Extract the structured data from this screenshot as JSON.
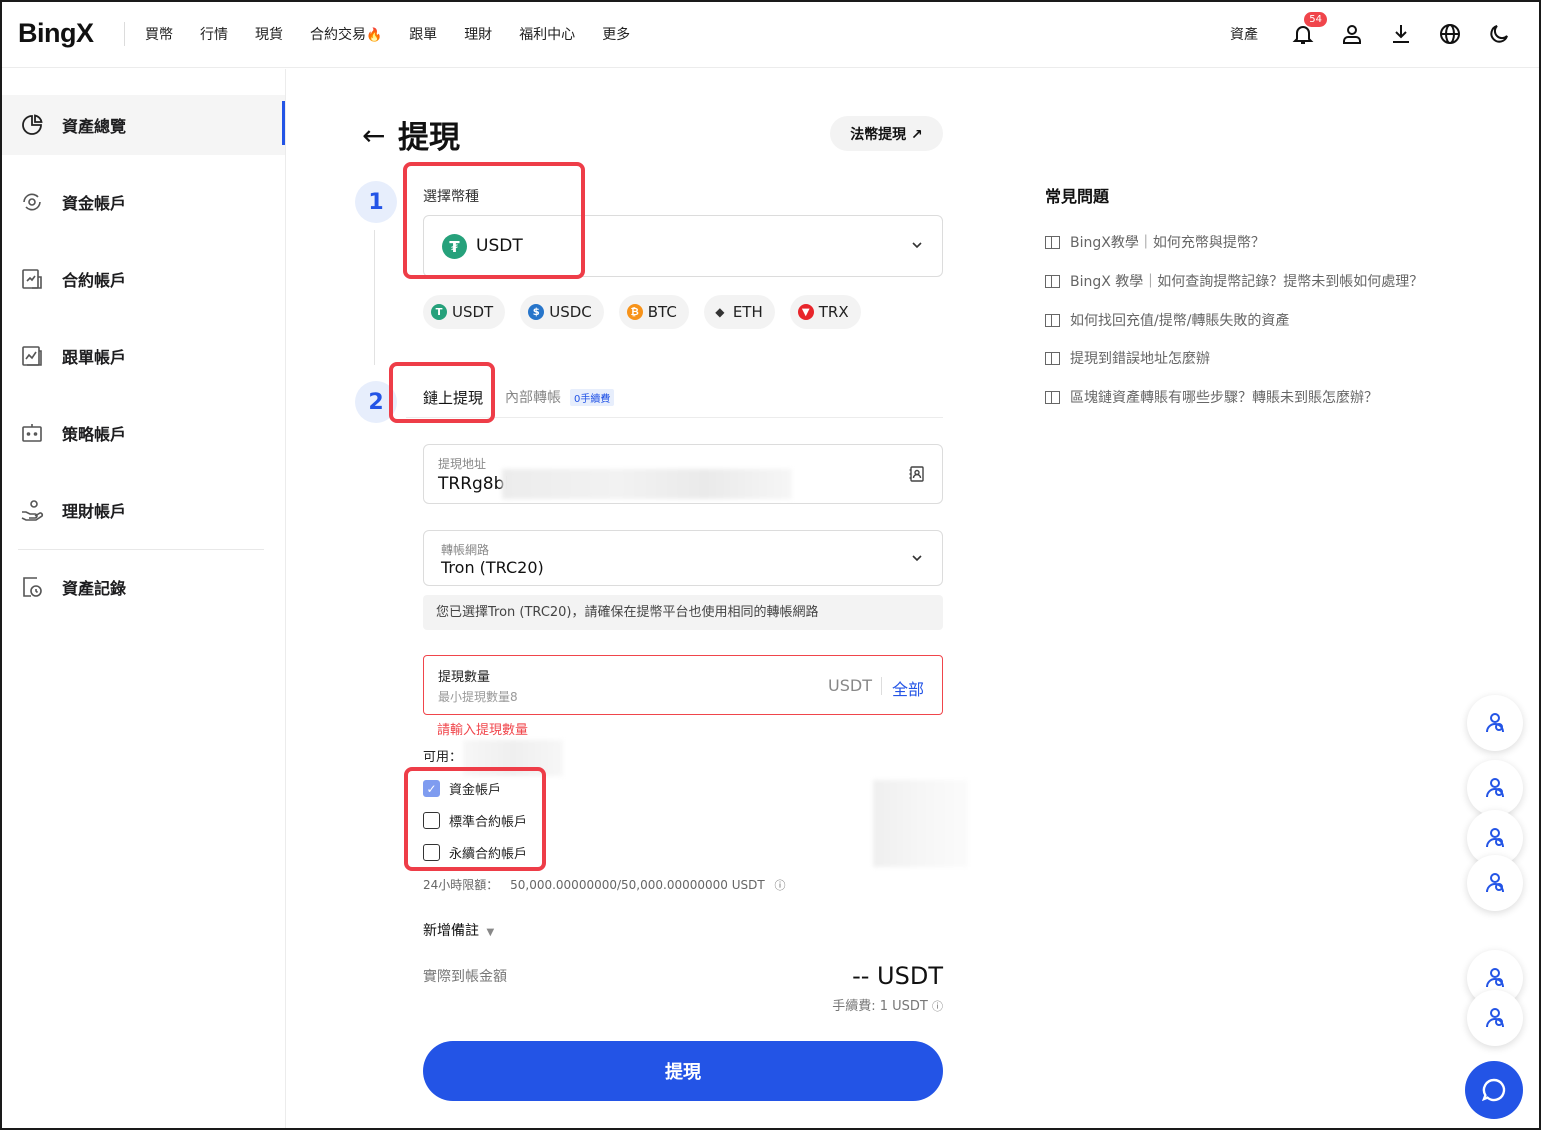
{
  "header": {
    "logo": "BingX",
    "nav": [
      "買幣",
      "行情",
      "現貨",
      "合約交易",
      "跟單",
      "理財",
      "福利中心",
      "更多"
    ],
    "assets_label": "資產",
    "notification_count": "54"
  },
  "sidebar": {
    "items": [
      {
        "label": "資產總覽",
        "icon": "pie-chart-icon",
        "active": true
      },
      {
        "label": "資金帳戶",
        "icon": "fund-refresh-icon"
      },
      {
        "label": "合約帳戶",
        "icon": "contract-chart-icon"
      },
      {
        "label": "跟單帳戶",
        "icon": "copy-trade-icon"
      },
      {
        "label": "策略帳戶",
        "icon": "robot-icon"
      },
      {
        "label": "理財帳戶",
        "icon": "hand-coin-icon"
      },
      {
        "label": "資產記錄",
        "icon": "record-clock-icon"
      }
    ]
  },
  "page": {
    "title": "提現",
    "fiat_button": "法幣提現 ↗"
  },
  "step1": {
    "number": "1",
    "label": "選擇幣種",
    "selected_coin": "USDT",
    "quick_coins": [
      {
        "name": "USDT",
        "color": "#26a17b",
        "glyph": "T"
      },
      {
        "name": "USDC",
        "color": "#2775ca",
        "glyph": "$"
      },
      {
        "name": "BTC",
        "color": "#f7931a",
        "glyph": "₿"
      },
      {
        "name": "ETH",
        "color": "#444444",
        "glyph": "◆"
      },
      {
        "name": "TRX",
        "color": "#e8252b",
        "glyph": "▼"
      }
    ]
  },
  "step2": {
    "number": "2",
    "tab_active": "鏈上提現",
    "tab_internal": "內部轉帳",
    "fee_tag": "0手續費",
    "address_label": "提現地址",
    "address_value": "TRRg8bl",
    "network_label": "轉帳網路",
    "network_value": "Tron (TRC20)",
    "network_note": "您已選擇Tron (TRC20)，請確保在提幣平台也使用相同的轉帳網路",
    "amount_label": "提現數量",
    "amount_placeholder": "最小提現數量8",
    "amount_unit": "USDT",
    "amount_all": "全部",
    "amount_error": "請輸入提現數量",
    "available_label": "可用：",
    "accounts": [
      {
        "label": "資金帳戶",
        "checked": true
      },
      {
        "label": "標準合約帳戶",
        "checked": false
      },
      {
        "label": "永續合約帳戶",
        "checked": false
      }
    ],
    "limit_label": "24小時限額：",
    "limit_value": "50,000.00000000/50,000.00000000 USDT",
    "memo_label": "新增備註",
    "receive_label": "實際到帳金額",
    "receive_value": "-- USDT",
    "fee_text": "手續費: 1 USDT",
    "submit": "提現"
  },
  "faq": {
    "title": "常見問題",
    "items": [
      "BingX教學｜如何充幣與提幣？",
      "BingX 教學｜如何查詢提幣記錄？提幣未到帳如何處理？",
      "如何找回充值/提幣/轉賬失敗的資產",
      "提現到錯誤地址怎麼辦",
      "區塊鏈資產轉賬有哪些步驟？轉賬未到賬怎麼辦？"
    ]
  },
  "colors": {
    "accent": "#2354e6",
    "error": "#f0454b",
    "highlight_box": "#ee3d48"
  }
}
